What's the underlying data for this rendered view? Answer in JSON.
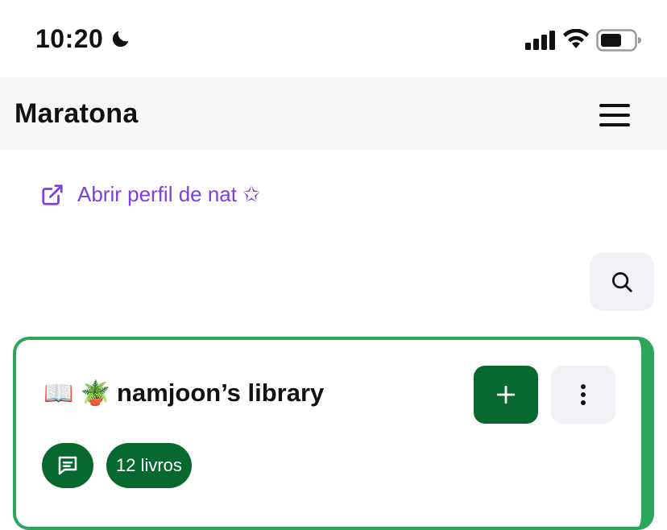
{
  "status_bar": {
    "time": "10:20"
  },
  "navbar": {
    "brand": "Maratona"
  },
  "profile_link": {
    "label": "Abrir perfil de nat ✩"
  },
  "library": {
    "emoji": "📖 🪴",
    "title": "namjoon’s library",
    "book_count": "12 livros"
  },
  "colors": {
    "accent_green": "#08692e",
    "border_green": "#2da55a",
    "link_purple": "#7b3fe4"
  }
}
